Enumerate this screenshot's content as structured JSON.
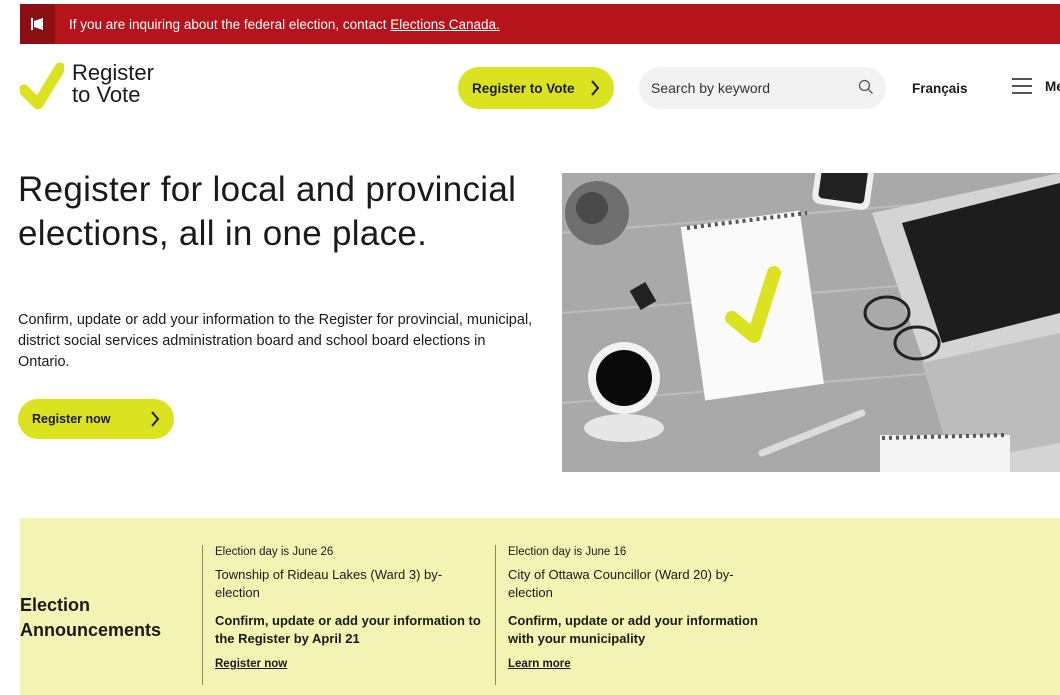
{
  "alert": {
    "text": "If you are inquiring about the federal election, contact",
    "link": "Elections Canada."
  },
  "header": {
    "logo_line1": "Register",
    "logo_line2": "to Vote",
    "register_button": "Register to Vote",
    "search_placeholder": "Search by keyword",
    "language": "Français",
    "menu": "Me"
  },
  "hero": {
    "title": "Register for local and provincial elections, all in one place.",
    "description": "Confirm, update or add your information to the Register for provincial, municipal, district social services administration board and school board elections in Ontario.",
    "button": "Register now"
  },
  "announcements": {
    "heading": "Election Announcements",
    "items": [
      {
        "date": "Election day is June 26",
        "name": "Township of Rideau Lakes (Ward 3) by-election",
        "confirm": "Confirm, update or add your information to the Register by April 21",
        "link": "Register now"
      },
      {
        "date": "Election day is June 16",
        "name": "City of Ottawa Councillor (Ward 20) by-election",
        "confirm": "Confirm, update or add your information with your municipality",
        "link": "Learn more"
      }
    ]
  },
  "colors": {
    "alert_red": "#b5141d",
    "brand_yellow": "#dbe321",
    "announce_bg": "#f3f4b4"
  }
}
